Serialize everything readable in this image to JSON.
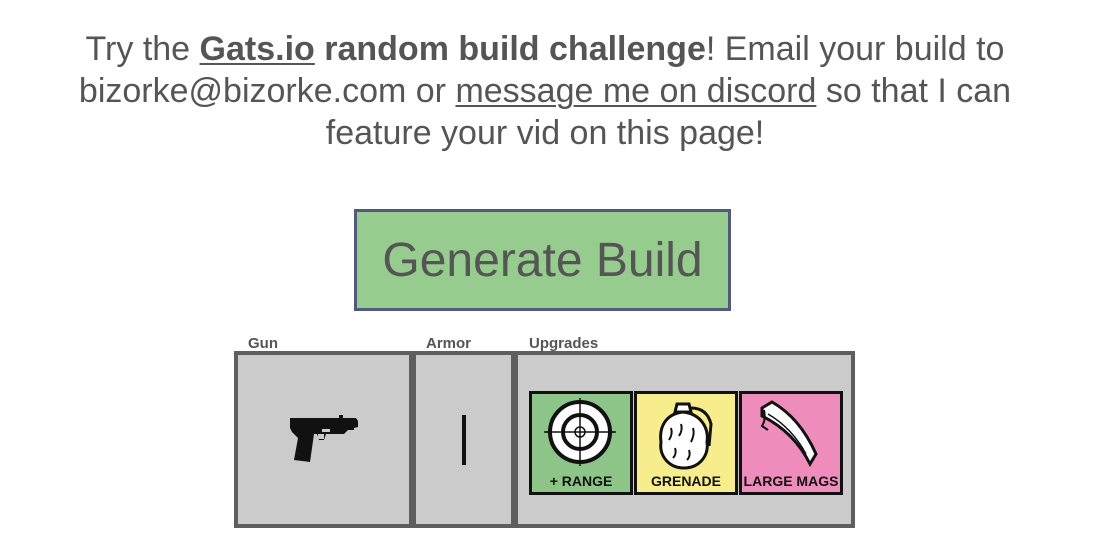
{
  "intro": {
    "prefix": "Try the ",
    "site_link": "Gats.io",
    "challenge": " random build challenge",
    "middle": "! Email your build to bizorke@bizorke.com or ",
    "discord_link": "message me on discord",
    "suffix": " so that I can feature your vid on this page!"
  },
  "generate_button": {
    "label": "Generate Build",
    "color": "#96cc8e"
  },
  "build": {
    "gun_label": "Gun",
    "armor_label": "Armor",
    "upgrades_label": "Upgrades",
    "gun_icon": "pistol-icon",
    "armor_icon": "armor-level-bar-icon",
    "upgrades": [
      {
        "label": "+ RANGE",
        "icon": "crosshair-target-icon",
        "color": "#8dc487"
      },
      {
        "label": "GRENADE",
        "icon": "grenade-icon",
        "color": "#f7ed8d"
      },
      {
        "label": "LARGE MAGS",
        "icon": "magazine-icon",
        "color": "#ee8cbb"
      }
    ]
  }
}
